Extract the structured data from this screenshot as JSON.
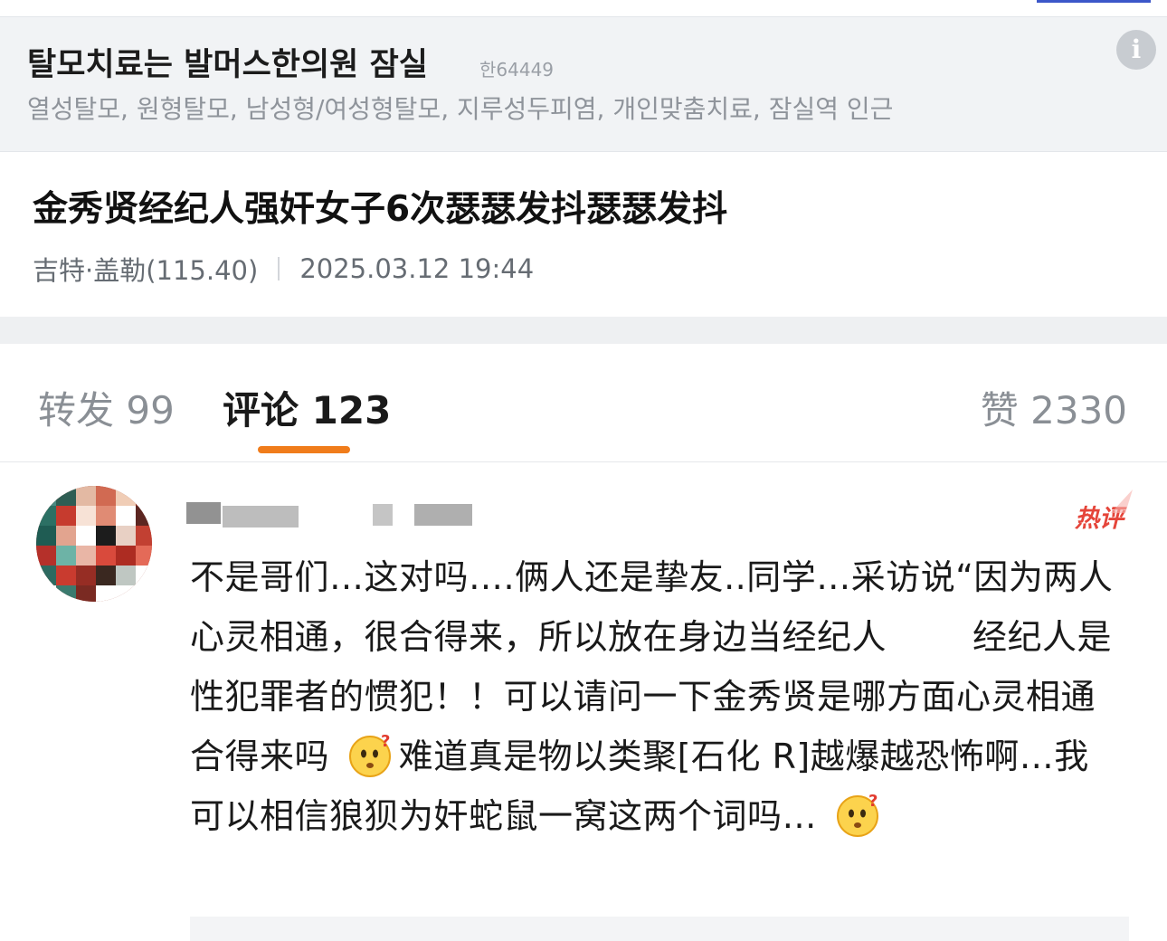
{
  "ad": {
    "title": "탈모치료는 발머스한의원 잠실",
    "code": "한64449",
    "tags": "열성탈모, 원형탈모, 남성형/여성형탈모, 지루성두피염, 개인맞춤치료, 잠실역 인근",
    "info_icon": "info-icon"
  },
  "post": {
    "title": "金秀贤经纪人强奸女子6次瑟瑟发抖瑟瑟发抖",
    "author": "吉特·盖勒(115.40)",
    "timestamp": "2025.03.12 19:44"
  },
  "tabs": {
    "repost": "转发 99",
    "comment": "评论 123",
    "like": "赞 2330",
    "active_color": "#f07c1b"
  },
  "comment": {
    "badge": "热评",
    "badge_color": "#e5453a",
    "text_1": "不是哥们…这对吗….俩人还是挚友..同学…采访说“因为两人心灵相通，很合得来，所以放在身边当经纪人",
    "text_2": "经纪人是性犯罪者的惯犯！！可以请问一下金秀贤是哪方面心灵相通合得来吗",
    "text_3": "难道真是物以类聚[石化 R]越爆越恐怖啊…我可以相信狼狈为奸蛇鼠一窝这两个词吗…",
    "emoji_icon": "thinking-face-icon"
  }
}
